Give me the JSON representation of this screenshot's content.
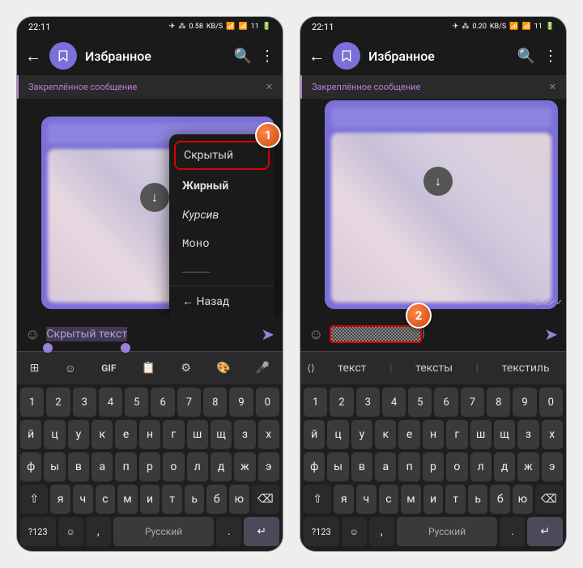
{
  "status": {
    "time": "22:11",
    "net": "0.58",
    "net2": "0.20",
    "unit": "KB/S",
    "batt": "11"
  },
  "app": {
    "title": "Избранное",
    "pinned": "Закреплённое сообщение",
    "timestamp": "13:45"
  },
  "menu": {
    "hidden": "Скрытый",
    "bold": "Жирный",
    "italic": "Курсив",
    "mono": "Моно",
    "back": "Назад"
  },
  "input": {
    "text1": "Скрытый текст"
  },
  "suggest": {
    "s1": "текст",
    "s2": "тексты",
    "s3": "текстиль"
  },
  "kb": {
    "top": {
      "gif": "GIF"
    },
    "nums": [
      "1",
      "2",
      "3",
      "4",
      "5",
      "6",
      "7",
      "8",
      "9",
      "0"
    ],
    "r1": [
      "й",
      "ц",
      "у",
      "к",
      "е",
      "н",
      "г",
      "ш",
      "щ",
      "з",
      "х"
    ],
    "r2": [
      "ф",
      "ы",
      "в",
      "а",
      "п",
      "р",
      "о",
      "л",
      "д",
      "ж",
      "э"
    ],
    "r3": [
      "я",
      "ч",
      "с",
      "м",
      "и",
      "т",
      "ь",
      "б",
      "ю"
    ],
    "sym": "?123",
    "lang": "Русский"
  },
  "markers": {
    "m1": "1",
    "m2": "2"
  }
}
